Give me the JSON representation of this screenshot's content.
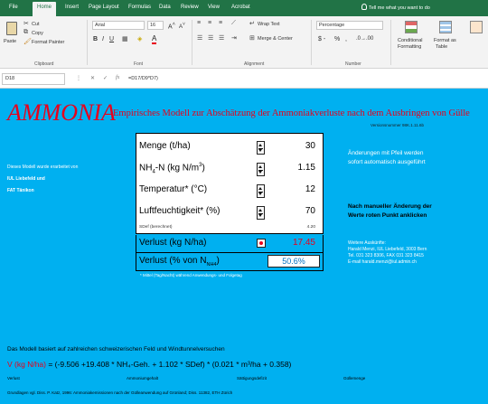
{
  "ribbon_tabs": [
    "File",
    "Home",
    "Insert",
    "Page Layout",
    "Formulas",
    "Data",
    "Review",
    "View",
    "Acrobat"
  ],
  "tell_me": "Tell me what you want to do",
  "clipboard": {
    "paste": "Paste",
    "cut": "Cut",
    "copy": "Copy",
    "format_painter": "Format Painter",
    "label": "Clipboard"
  },
  "font": {
    "name": "Arial",
    "size": "16",
    "label": "Font"
  },
  "alignment": {
    "wrap": "Wrap Text",
    "merge": "Merge & Center",
    "label": "Alignment"
  },
  "number": {
    "format": "Percentage",
    "label": "Number"
  },
  "styles": {
    "conditional": "Conditional",
    "formatting": "Formatting",
    "format_as": "Format as",
    "table": "Table"
  },
  "formula_bar": {
    "cell_ref": "D18",
    "formula": "=D17/D9*D7)"
  },
  "sheet": {
    "title": "AMMONIA",
    "subtitle": "Empirisches Modell zur Abschätzung der Ammoniakverluste nach dem Ausbringen von Gülle",
    "version": "Versionsnummer 98K.1.11.6b",
    "left_note_1": "Dieses Modell wurde erarbeitet von",
    "left_note_2": "IUL Liebefeld und",
    "left_note_3": "FAT Tänikon",
    "inputs": [
      {
        "label_main": "Menge (t/ha)",
        "value": "30"
      },
      {
        "label_main": "NH₄-N (kg N/m³)",
        "value": "1.15"
      },
      {
        "label_main": "Temperatur* (°C)",
        "value": "12"
      },
      {
        "label_main": "Luftfeuchtigkeit* (%)",
        "value": "70"
      }
    ],
    "sdef_label": "SDef (berechnet)",
    "sdef_value": "4.20",
    "loss_label": "Verlust (kg N/ha)",
    "loss_value": "17.45",
    "loss_pct_label": "Verlust (% von N",
    "loss_pct_sub": "NH4",
    "loss_pct_close": ")",
    "loss_pct_value": "50.6%",
    "footnote": "* Mittel (Tag/Nacht) während Anwendungs- und Folgetag",
    "right_1": "Änderungen mit Pfeil werden",
    "right_2": "sofort automatisch ausgeführt",
    "right_3": "Nach manueller Änderung der",
    "right_4": "Werte roten Punkt anklicken",
    "contact_1": "Weitere Auskünfte:",
    "contact_2": "Harald Menzi, IUL Liebefeld, 3003 Bern",
    "contact_3": "Tel. 031 323 8306, FAX 031 323 8415",
    "contact_4": "E-mail harald.menzi@iul.admin.ch",
    "basis": "Das Modell basiert auf zahlreichen schweizerischen Feld und Windtunnelversuchen",
    "formula_lhs": "V (kg N/ha)",
    "formula_rhs": " = (-9.506 +19.408 * NH₄-Geh. + 1.102 * SDef) * (0.021 * m³/ha + 0.358)",
    "legend_1": "Verlust",
    "legend_2": "Ammoniumgehalt",
    "legend_3": "Sättigungsdefizit",
    "legend_4": "Güllemenge",
    "basis2": "Grundlagen vgl. Diss. P. Katz, 1996: Ammoniakemissionen nach der Gülleanwendung auf Grünland; Diss. 11382, ETH Zürich"
  }
}
